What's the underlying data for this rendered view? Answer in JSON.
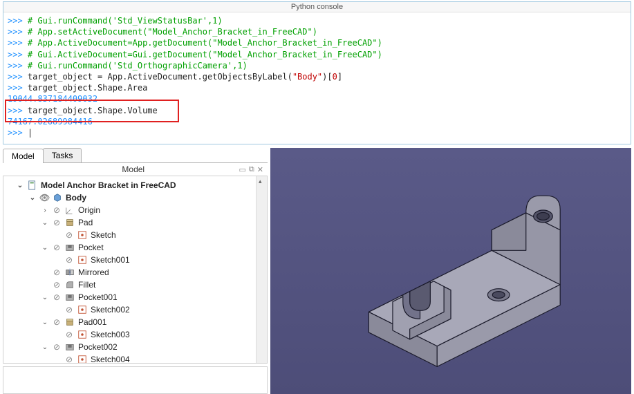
{
  "console": {
    "title": "Python console",
    "lines": [
      {
        "type": "comment",
        "text": "# Gui.runCommand('Std_ViewStatusBar',1)"
      },
      {
        "type": "comment",
        "text": "# App.setActiveDocument(\"Model_Anchor_Bracket_in_FreeCAD\")"
      },
      {
        "type": "comment",
        "text": "# App.ActiveDocument=App.getDocument(\"Model_Anchor_Bracket_in_FreeCAD\")"
      },
      {
        "type": "comment",
        "text": "# Gui.ActiveDocument=Gui.getDocument(\"Model_Anchor_Bracket_in_FreeCAD\")"
      },
      {
        "type": "comment",
        "text": "# Gui.runCommand('Std_OrthographicCamera',1)"
      }
    ],
    "line_code_pre": "target_object = App.ActiveDocument.getObjectsByLabel(",
    "line_code_str": "\"Body\"",
    "line_code_post": ")[",
    "line_code_idx": "0",
    "line_code_end": "]",
    "area_cmd": "target_object.Shape.Area",
    "area_result": "19044.837184409032",
    "volume_cmd": "target_object.Shape.Volume",
    "volume_result": "74167.02689984416",
    "prompt": ">>> "
  },
  "tabs": {
    "model": "Model",
    "tasks": "Tasks"
  },
  "panel": {
    "title": "Model",
    "icons": {
      "float": "▭",
      "detach": "⧉",
      "close": "✕"
    }
  },
  "tree": {
    "root": "Model Anchor Bracket in FreeCAD",
    "body": "Body",
    "origin": "Origin",
    "pad": "Pad",
    "sketch": "Sketch",
    "pocket": "Pocket",
    "sketch001": "Sketch001",
    "mirrored": "Mirrored",
    "fillet": "Fillet",
    "pocket001": "Pocket001",
    "sketch002": "Sketch002",
    "pad001": "Pad001",
    "sketch003": "Sketch003",
    "pocket002": "Pocket002",
    "sketch004": "Sketch004"
  }
}
